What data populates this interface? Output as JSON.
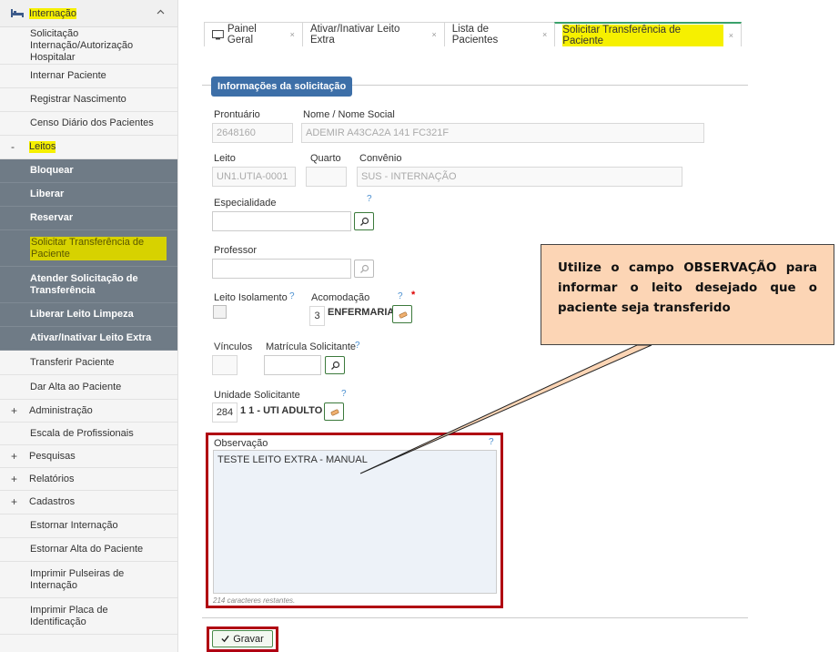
{
  "sidebar": {
    "header": "Internação",
    "items": [
      {
        "label": "Solicitação Internação/Autorização Hospitalar"
      },
      {
        "label": "Internar Paciente"
      },
      {
        "label": "Registrar Nascimento"
      },
      {
        "label": "Censo Diário dos Pacientes"
      }
    ],
    "leitos_sign": "-",
    "leitos_label": "Leitos",
    "leitos_items": [
      {
        "label": "Bloquear"
      },
      {
        "label": "Liberar"
      },
      {
        "label": "Reservar"
      },
      {
        "label": "Solicitar Transferência de Paciente"
      },
      {
        "label": "Atender Solicitação de Transferência"
      },
      {
        "label": "Liberar Leito Limpeza"
      },
      {
        "label": "Ativar/Inativar Leito Extra"
      }
    ],
    "items_after": [
      {
        "label": "Transferir Paciente"
      },
      {
        "label": "Dar Alta ao Paciente"
      }
    ],
    "groups": [
      {
        "sign": "+",
        "label": "Administração"
      },
      {
        "sign": "",
        "label": "Escala de Profissionais"
      },
      {
        "sign": "+",
        "label": "Pesquisas"
      },
      {
        "sign": "+",
        "label": "Relatórios"
      },
      {
        "sign": "+",
        "label": "Cadastros"
      }
    ],
    "items_end": [
      {
        "label": "Estornar Internação"
      },
      {
        "label": "Estornar Alta do Paciente"
      },
      {
        "label": "Imprimir Pulseiras de Internação"
      },
      {
        "label": "Imprimir Placa de Identificação"
      }
    ]
  },
  "tabs": [
    {
      "label": "Painel Geral"
    },
    {
      "label": "Ativar/Inativar Leito Extra"
    },
    {
      "label": "Lista de Pacientes"
    },
    {
      "label": "Solicitar Transferência de Paciente"
    }
  ],
  "tab_close": "×",
  "form": {
    "section_title": "Informações da solicitação",
    "prontuario_label": "Prontuário",
    "prontuario_value": "2648160",
    "nome_label": "Nome / Nome Social",
    "nome_value": "ADEMIR A43CA2A 141 FC321F",
    "leito_label": "Leito",
    "leito_value": "UN1.UTIA-0001",
    "quarto_label": "Quarto",
    "quarto_value": "",
    "convenio_label": "Convênio",
    "convenio_value": "SUS - INTERNAÇÃO",
    "especialidade_label": "Especialidade",
    "professor_label": "Professor",
    "leito_isolamento_label": "Leito Isolamento",
    "acomodacao_label": "Acomodação",
    "acomodacao_code": "3",
    "acomodacao_value": "ENFERMARIA",
    "vinculos_label": "Vínculos",
    "matricula_label": "Matrícula Solicitante",
    "unidade_label": "Unidade Solicitante",
    "unidade_code": "284",
    "unidade_value": "1 1 - UTI ADULTO",
    "observacao_label": "Observação",
    "observacao_value": "TESTE LEITO EXTRA - MANUAL",
    "observacao_count": "214 caracteres restantes.",
    "help": "?",
    "required": "*",
    "save_label": "Gravar"
  },
  "callout": {
    "text": "Utilize o campo OBSERVAÇÃO para informar o leito desejado que o paciente seja transferido"
  },
  "colors": {
    "highlight": "#f6f000",
    "annotation_red": "#b00012",
    "callout_bg": "#fcd5b5",
    "section_blue": "#3d6fa8",
    "sidebar_sub": "#6f7b86"
  }
}
